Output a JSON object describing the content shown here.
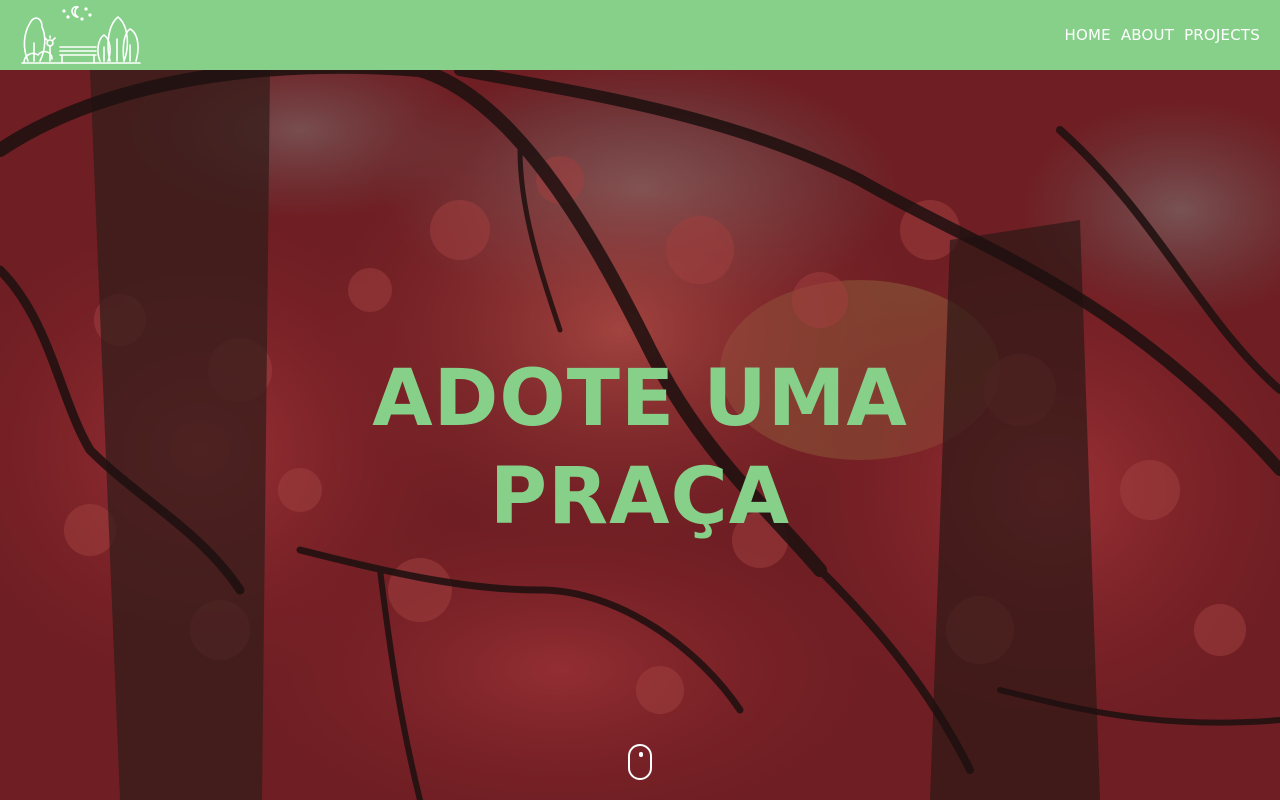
{
  "nav": {
    "logo_icon": "park-trees-bench-logo-icon",
    "links": [
      {
        "label": "HOME"
      },
      {
        "label": "ABOUT"
      },
      {
        "label": "PROJECTS"
      }
    ]
  },
  "hero": {
    "title_line1": "ADOTE UMA",
    "title_line2": "PRAÇA",
    "scroll_icon": "mouse-scroll-icon",
    "background_icon": "red-autumn-maple-trees-photo"
  },
  "colors": {
    "navbar": "#86d08a",
    "title": "#86d08a",
    "nav_text": "#ffffff"
  }
}
